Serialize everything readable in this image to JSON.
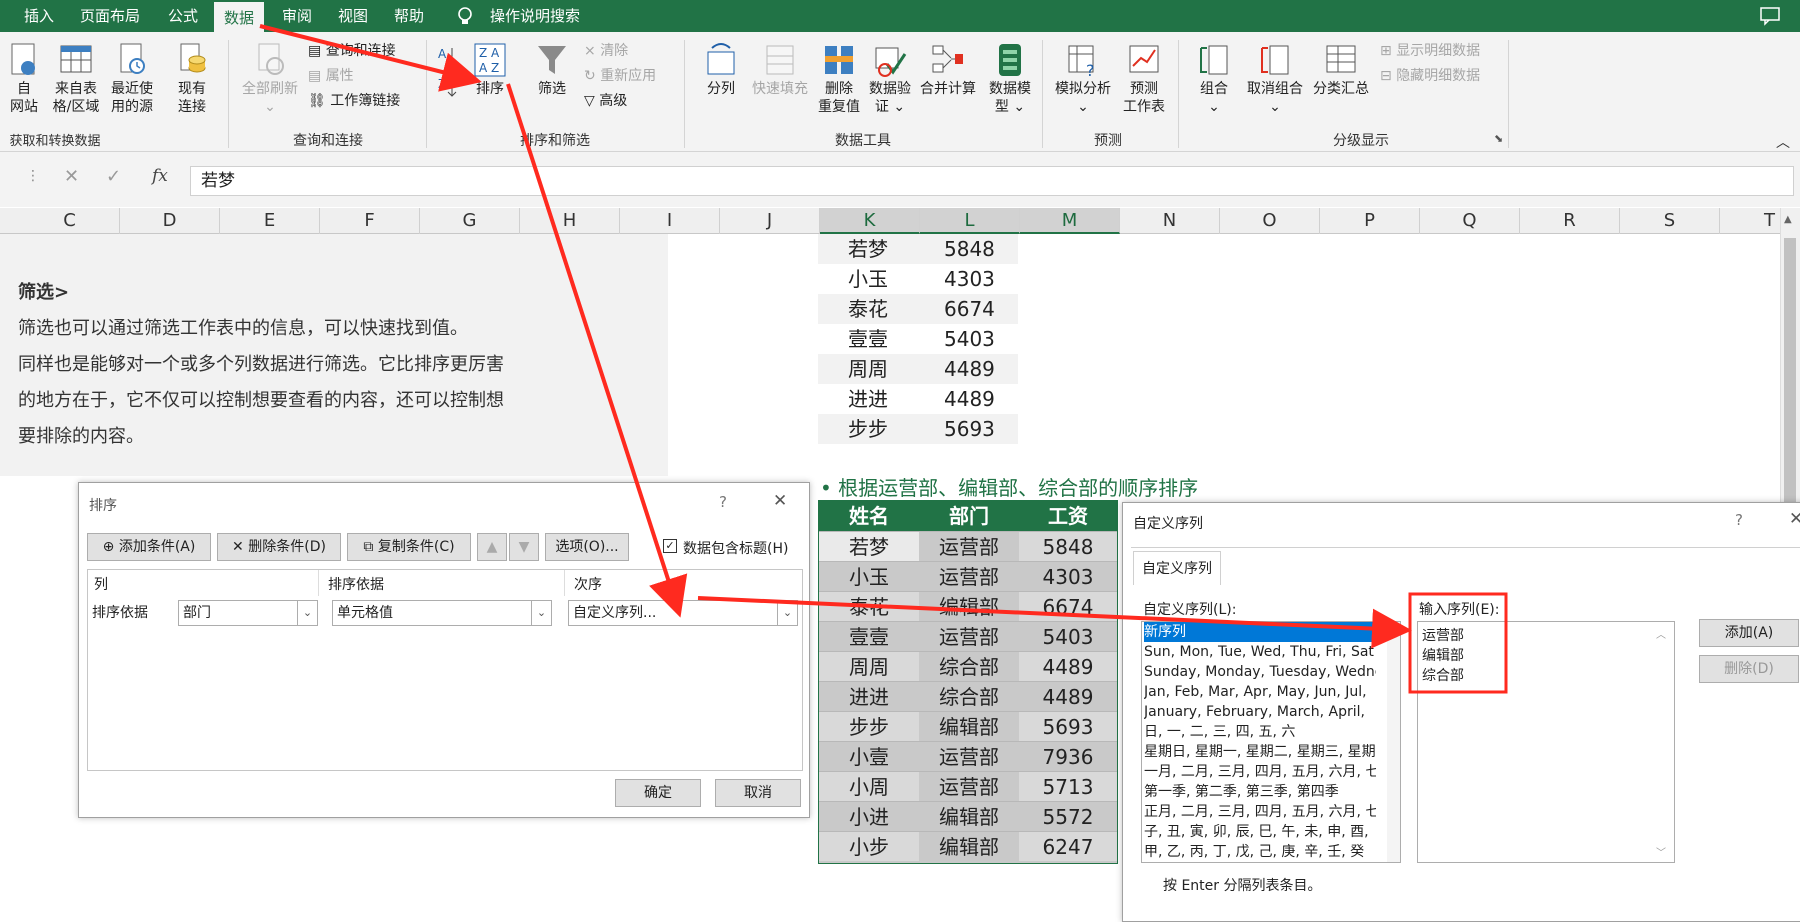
{
  "ribbon_tabs": [
    {
      "label": "插入",
      "active": false
    },
    {
      "label": "页面布局",
      "active": false
    },
    {
      "label": "公式",
      "active": false
    },
    {
      "label": "数据",
      "active": true
    },
    {
      "label": "审阅",
      "active": false
    },
    {
      "label": "视图",
      "active": false
    },
    {
      "label": "帮助",
      "active": false
    }
  ],
  "search_label": "操作说明搜索",
  "ribbon": {
    "get_group": {
      "buttons": [
        "自\n网站",
        "来自表\n格/区域",
        "最近使\n用的源",
        "现有\n连接"
      ],
      "label": "获取和转换数据"
    },
    "query_group": {
      "refresh": "全部刷新",
      "items": [
        "查询和连接",
        "属性",
        "工作簿链接"
      ],
      "label": "查询和连接"
    },
    "sort_group": {
      "sort": "排序",
      "filter": "筛选",
      "items": [
        "清除",
        "重新应用",
        "高级"
      ],
      "label": "排序和筛选"
    },
    "tools_group": {
      "buttons": [
        "分列",
        "快速填充",
        "删除\n重复值",
        "数据验\n证 ⌄",
        "合并计算",
        "数据模\n型 ⌄"
      ],
      "label": "数据工具"
    },
    "forecast_group": {
      "buttons": [
        "模拟分析\n⌄",
        "预测\n工作表"
      ],
      "label": "预测"
    },
    "outline_group": {
      "buttons": [
        "组合\n⌄",
        "取消组合\n⌄",
        "分类汇总"
      ],
      "items": [
        "显示明细数据",
        "隐藏明细数据"
      ],
      "label": "分级显示"
    }
  },
  "formula_bar": {
    "fx": "fx",
    "value": "若梦"
  },
  "columns": [
    "C",
    "D",
    "E",
    "F",
    "G",
    "H",
    "I",
    "J",
    "K",
    "L",
    "M",
    "N",
    "O",
    "P",
    "Q",
    "R",
    "S",
    "T"
  ],
  "text_block": {
    "heading": "筛选>",
    "lines": [
      "筛选也可以通过筛选工作表中的信息，可以快速找到值。",
      "同样也是能够对一个或多个列数据进行筛选。它比排序更厉害",
      "的地方在于，它不仅可以控制想要查看的内容，还可以控制想",
      "要排除的内容。"
    ]
  },
  "top_table": [
    {
      "name": "若梦",
      "salary": "5848"
    },
    {
      "name": "小玉",
      "salary": "4303"
    },
    {
      "name": "泰花",
      "salary": "6674"
    },
    {
      "name": "壹壹",
      "salary": "5403"
    },
    {
      "name": "周周",
      "salary": "4489"
    },
    {
      "name": "进进",
      "salary": "4489"
    },
    {
      "name": "步步",
      "salary": "5693"
    }
  ],
  "section_title": "• 根据运营部、编辑部、综合部的顺序排序",
  "bottom_table": {
    "headers": [
      "姓名",
      "部门",
      "工资"
    ],
    "rows": [
      [
        "若梦",
        "运营部",
        "5848"
      ],
      [
        "小玉",
        "运营部",
        "4303"
      ],
      [
        "泰花",
        "编辑部",
        "6674"
      ],
      [
        "壹壹",
        "运营部",
        "5403"
      ],
      [
        "周周",
        "综合部",
        "4489"
      ],
      [
        "进进",
        "综合部",
        "4489"
      ],
      [
        "步步",
        "编辑部",
        "5693"
      ],
      [
        "小壹",
        "运营部",
        "7936"
      ],
      [
        "小周",
        "运营部",
        "5713"
      ],
      [
        "小进",
        "编辑部",
        "5572"
      ],
      [
        "小步",
        "编辑部",
        "6247"
      ]
    ]
  },
  "sort_dialog": {
    "title": "排序",
    "help": "?",
    "close": "✕",
    "add": "添加条件(A)",
    "delete": "删除条件(D)",
    "copy": "复制条件(C)",
    "options": "选项(O)...",
    "has_header": "数据包含标题(H)",
    "col_header": "列",
    "basis_header": "排序依据",
    "order_header": "次序",
    "row_label": "排序依据",
    "col_value": "部门",
    "basis_value": "单元格值",
    "order_value": "自定义序列...",
    "ok": "确定",
    "cancel": "取消"
  },
  "custom_dialog": {
    "title": "自定义序列",
    "help": "?",
    "close": "✕",
    "tab": "自定义序列",
    "lists_label": "自定义序列(L):",
    "lists": [
      "新序列",
      "Sun, Mon, Tue, Wed, Thu, Fri, Sat",
      "Sunday, Monday, Tuesday, Wednesday",
      "Jan, Feb, Mar, Apr, May, Jun, Jul,",
      "January, February, March, April,",
      "日, 一, 二, 三, 四, 五, 六",
      "星期日, 星期一, 星期二, 星期三, 星期",
      "一月, 二月, 三月, 四月, 五月, 六月, 七",
      "第一季, 第二季, 第三季, 第四季",
      "正月, 二月, 三月, 四月, 五月, 六月, 七",
      "子, 丑, 寅, 卯, 辰, 巳, 午, 未, 申, 酉,",
      "甲, 乙, 丙, 丁, 戊, 己, 庚, 辛, 壬, 癸"
    ],
    "entries_label": "输入序列(E):",
    "entries": [
      "运营部",
      "编辑部",
      "综合部"
    ],
    "add": "添加(A)",
    "delete": "删除(D)",
    "hint": "按 Enter 分隔列表条目。"
  },
  "colors": {
    "accent": "#217346",
    "arrow": "#ff2a1f",
    "highlight": "#0078d7"
  }
}
